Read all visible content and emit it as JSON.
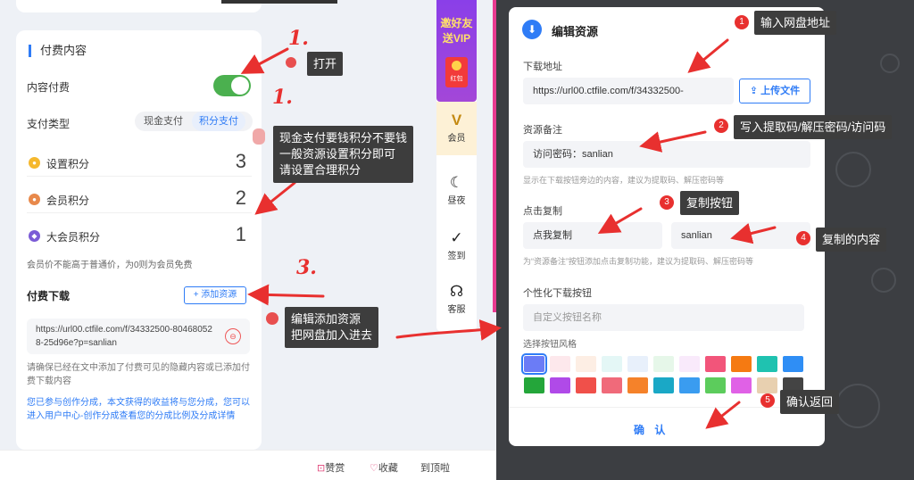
{
  "left": {
    "section_title": "付费内容",
    "content_paid_label": "内容付费",
    "content_paid_on": true,
    "pay_type_label": "支付类型",
    "pay_options": [
      "现金支付",
      "积分支付"
    ],
    "pay_selected": "积分支付",
    "scores": [
      {
        "label": "设置积分",
        "value": "3",
        "icon": "coin-icon",
        "color": "#f5b82e"
      },
      {
        "label": "会员积分",
        "value": "2",
        "icon": "member-badge-icon",
        "color": "#e8894b"
      },
      {
        "label": "大会员积分",
        "value": "1",
        "icon": "vip-badge-icon",
        "color": "#7b5bd6"
      }
    ],
    "member_hint": "会员价不能高于普通价，为0则为会员免费",
    "download_title": "付费下载",
    "add_resource_label": "+ 添加资源",
    "resource_url": "https://url00.ctfile.com/f/34332500-804680528-25d96e?p=sanlian",
    "delete_glyph": "⊖",
    "notice": "请确保已经在文中添加了付费可见的隐藏内容或已添加付费下载内容",
    "share_notice": "您已参与创作分成，本文获得的收益将与您分成，您可以进入用户中心-创作分成查看您的分成比例及分成详情"
  },
  "bottom_bar": {
    "like": "赞赏",
    "favorite": "收藏",
    "to_top": "到顶啦"
  },
  "side_panel": {
    "vip_banner": "邀好友送VIP",
    "red_packet": "红包",
    "items": [
      {
        "label": "会员",
        "glyph": "V"
      },
      {
        "label": "昼夜",
        "glyph": "☾"
      },
      {
        "label": "签到",
        "glyph": "✓"
      },
      {
        "label": "客服",
        "glyph": "☊"
      }
    ]
  },
  "modal": {
    "title": "编辑资源",
    "download_label": "下载地址",
    "download_value": "https://url00.ctfile.com/f/34332500-",
    "upload_label": "上传文件",
    "remark_label": "资源备注",
    "remark_value": "访问密码：sanlian",
    "remark_hint": "显示在下载按钮旁边的内容，建议为提取码、解压密码等",
    "copy_label": "点击复制",
    "copy_button_value": "点我复制",
    "copy_content_value": "sanlian",
    "copy_hint": "为“资源备注”按钮添加点击复制功能，建议为提取码、解压密码等",
    "custom_label": "个性化下载按钮",
    "custom_placeholder": "自定义按钮名称",
    "style_label": "选择按钮风格",
    "swatch_colors": [
      "#6b7cf6",
      "#fde8ec",
      "#fdeee4",
      "#e4f7f6",
      "#e8f0fb",
      "#e6f7e9",
      "#f9eafb",
      "#f2557a",
      "#f57a12",
      "#1fc2b0",
      "#2f8ef5",
      "#24a63a",
      "#b04ae8",
      "#f0504a",
      "#f06a7a",
      "#f5822a",
      "#1aa8c6",
      "#3a9cf0",
      "#5ccc5c",
      "#e061e6",
      "#e8d0b0",
      "#444444"
    ],
    "selected_swatch": 0,
    "confirm_label": "确 认"
  },
  "annotations": {
    "open_marker": "1.",
    "open_note": "打开",
    "pay_marker": "1.",
    "pay_note_lines": [
      "现金支付要钱积分不要钱",
      "一般资源设置积分即可",
      "请设置合理积分"
    ],
    "edit_marker": "3.",
    "edit_note_lines": [
      "编辑添加资源",
      "把网盘加入进去"
    ],
    "steps": [
      {
        "num": "1",
        "text": "输入网盘地址"
      },
      {
        "num": "2",
        "text": "写入提取码/解压密码/访问码"
      },
      {
        "num": "3",
        "text": "复制按钮"
      },
      {
        "num": "4",
        "text": "复制的内容"
      },
      {
        "num": "5",
        "text": "确认返回"
      }
    ]
  }
}
